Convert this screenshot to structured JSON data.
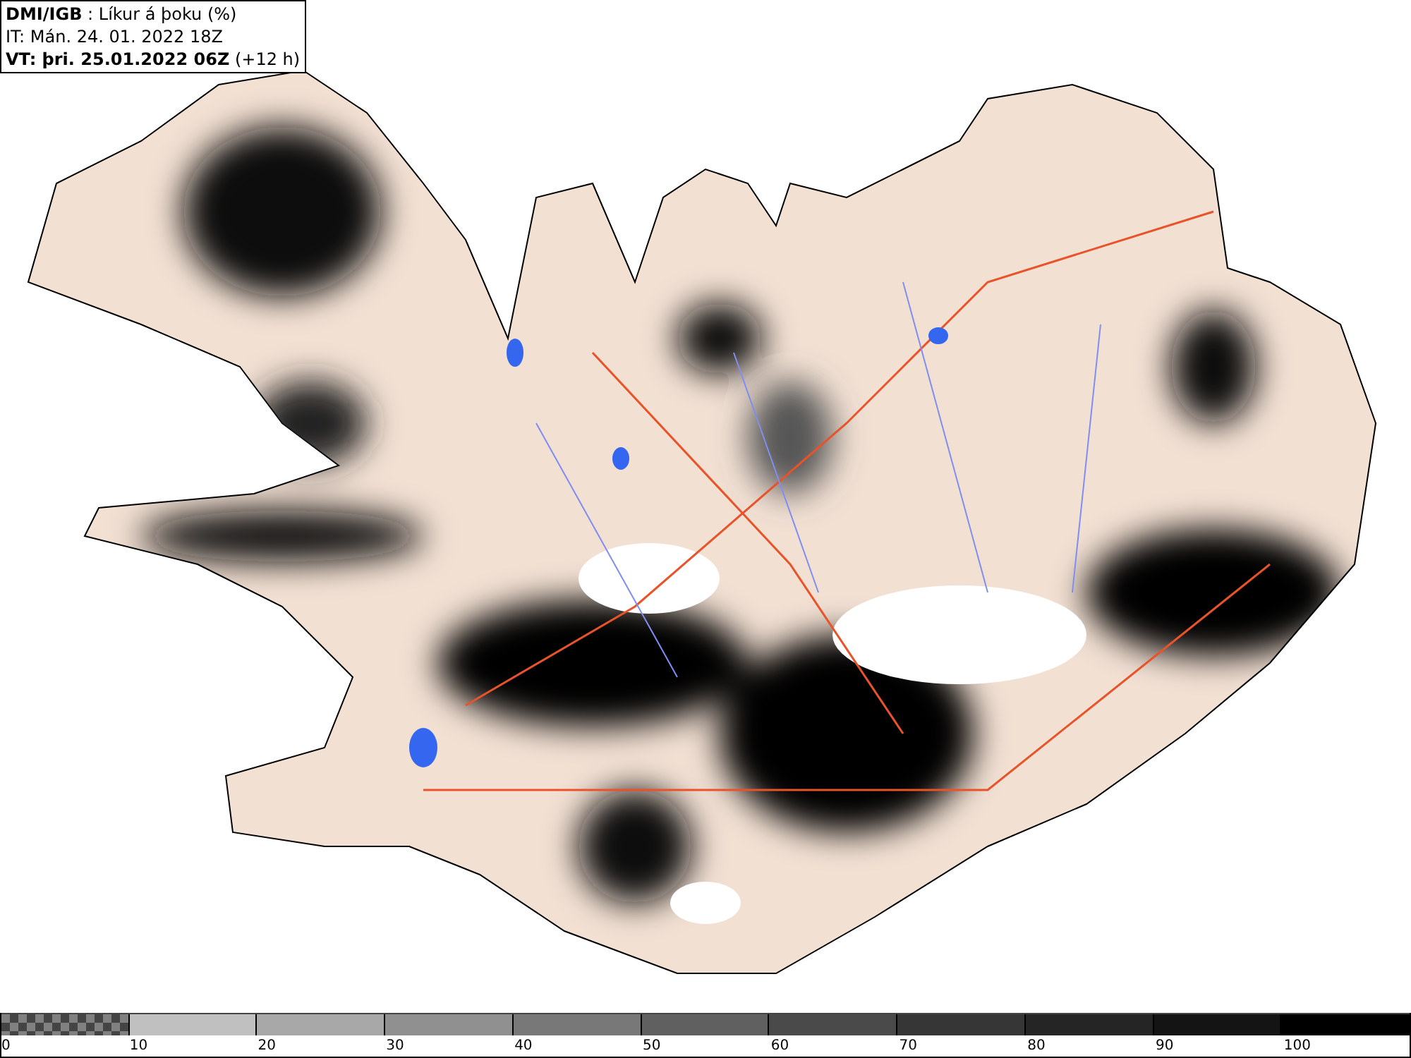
{
  "header": {
    "lines": [
      "**DMI/IGB** : Líkur á þoku (%)",
      "IT: Mán. 24. 01. 2022 18Z",
      "**VT: þri. 25.01.2022 06Z** (+12 h)"
    ]
  },
  "legend": {
    "segments": [
      {
        "kind": "checker",
        "color": "#808080"
      },
      {
        "kind": "solid",
        "color": "#c0c0c0"
      },
      {
        "kind": "solid",
        "color": "#a8a8a8"
      },
      {
        "kind": "solid",
        "color": "#909090"
      },
      {
        "kind": "solid",
        "color": "#787878"
      },
      {
        "kind": "solid",
        "color": "#606060"
      },
      {
        "kind": "solid",
        "color": "#4a4a4a"
      },
      {
        "kind": "solid",
        "color": "#363636"
      },
      {
        "kind": "solid",
        "color": "#252525"
      },
      {
        "kind": "solid",
        "color": "#141414"
      },
      {
        "kind": "solid",
        "color": "#000000"
      }
    ],
    "labels": [
      "0",
      "10",
      "20",
      "30",
      "40",
      "50",
      "60",
      "70",
      "80",
      "90",
      "100"
    ]
  }
}
